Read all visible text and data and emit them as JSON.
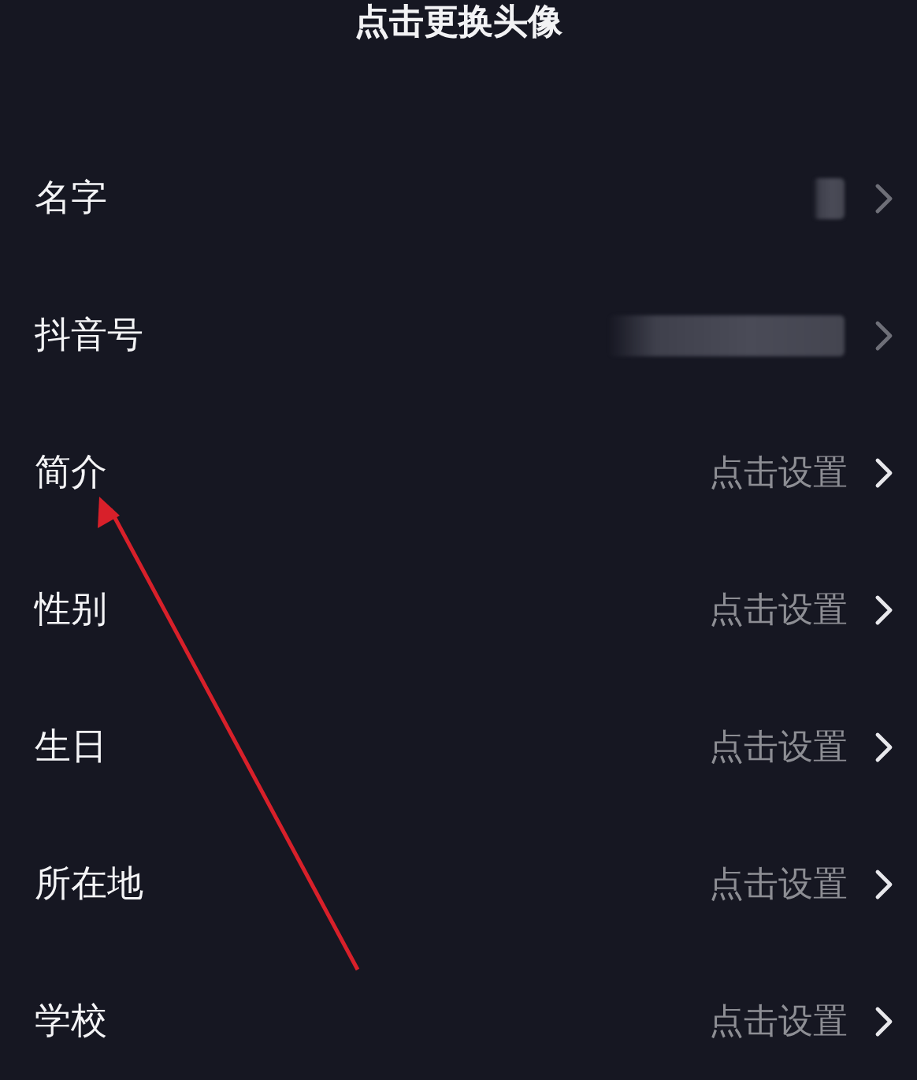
{
  "header": {
    "title": "点击更换头像"
  },
  "rows": [
    {
      "label": "名字",
      "kind": "blurred"
    },
    {
      "label": "抖音号",
      "kind": "blurred"
    },
    {
      "label": "简介",
      "kind": "value",
      "value": "点击设置"
    },
    {
      "label": "性别",
      "kind": "value",
      "value": "点击设置"
    },
    {
      "label": "生日",
      "kind": "value",
      "value": "点击设置"
    },
    {
      "label": "所在地",
      "kind": "value",
      "value": "点击设置"
    },
    {
      "label": "学校",
      "kind": "value",
      "value": "点击设置"
    }
  ],
  "annotation": {
    "kind": "arrow",
    "color": "#d8202a"
  }
}
